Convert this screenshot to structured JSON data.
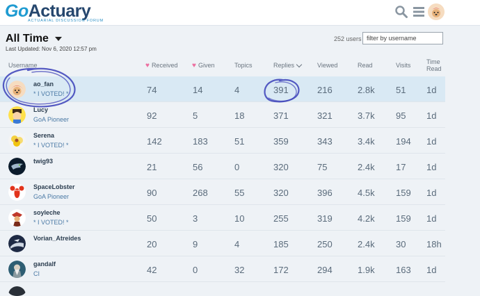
{
  "header": {
    "logo_main": "GoActuary",
    "logo_co": "Go",
    "logo_rest": "Actuary",
    "logo_sub": "ACTUARIAL DISCUSSION FORUM",
    "icons": [
      "search-icon",
      "hamburger-menu-icon",
      "user-avatar"
    ]
  },
  "toolbar": {
    "period": "All Time",
    "last_updated": "Last Updated: Nov 6, 2020 12:57 pm",
    "user_count": "252 users",
    "filter_placeholder": "filter by username"
  },
  "table": {
    "headers": {
      "username": "Username",
      "received": "Received",
      "given": "Given",
      "topics": "Topics",
      "replies": "Replies",
      "viewed": "Viewed",
      "read": "Read",
      "visits": "Visits",
      "time_read_1": "Time",
      "time_read_2": "Read"
    },
    "rows": [
      {
        "username": "ao_fan",
        "title": "* I VOTED! *",
        "received": "74",
        "given": "14",
        "topics": "4",
        "replies": "391",
        "viewed": "216",
        "read": "2.8k",
        "visits": "51",
        "time": "1d"
      },
      {
        "username": "Lucy",
        "title": "GoA Pioneer",
        "received": "92",
        "given": "5",
        "topics": "18",
        "replies": "371",
        "viewed": "321",
        "read": "3.7k",
        "visits": "95",
        "time": "1d"
      },
      {
        "username": "Serena",
        "title": "* I VOTED! *",
        "received": "142",
        "given": "183",
        "topics": "51",
        "replies": "359",
        "viewed": "343",
        "read": "3.4k",
        "visits": "194",
        "time": "1d"
      },
      {
        "username": "twig93",
        "title": "",
        "received": "21",
        "given": "56",
        "topics": "0",
        "replies": "320",
        "viewed": "75",
        "read": "2.4k",
        "visits": "17",
        "time": "1d"
      },
      {
        "username": "SpaceLobster",
        "title": "GoA Pioneer",
        "received": "90",
        "given": "268",
        "topics": "55",
        "replies": "320",
        "viewed": "396",
        "read": "4.5k",
        "visits": "159",
        "time": "1d"
      },
      {
        "username": "soyleche",
        "title": "* I VOTED! *",
        "received": "50",
        "given": "3",
        "topics": "10",
        "replies": "255",
        "viewed": "319",
        "read": "4.2k",
        "visits": "159",
        "time": "1d"
      },
      {
        "username": "Vorian_Atreides",
        "title": "",
        "received": "20",
        "given": "9",
        "topics": "4",
        "replies": "185",
        "viewed": "250",
        "read": "2.4k",
        "visits": "30",
        "time": "18h"
      },
      {
        "username": "gandalf",
        "title": "CI",
        "received": "42",
        "given": "0",
        "topics": "32",
        "replies": "172",
        "viewed": "294",
        "read": "1.9k",
        "visits": "163",
        "time": "1d"
      }
    ]
  },
  "colors": {
    "accent": "#1f9bd1",
    "brand_dark": "#26476e",
    "heart": "#ec6fa0",
    "highlight_row": "#d9e9f4",
    "annotation_ink": "#3a3fb8"
  }
}
